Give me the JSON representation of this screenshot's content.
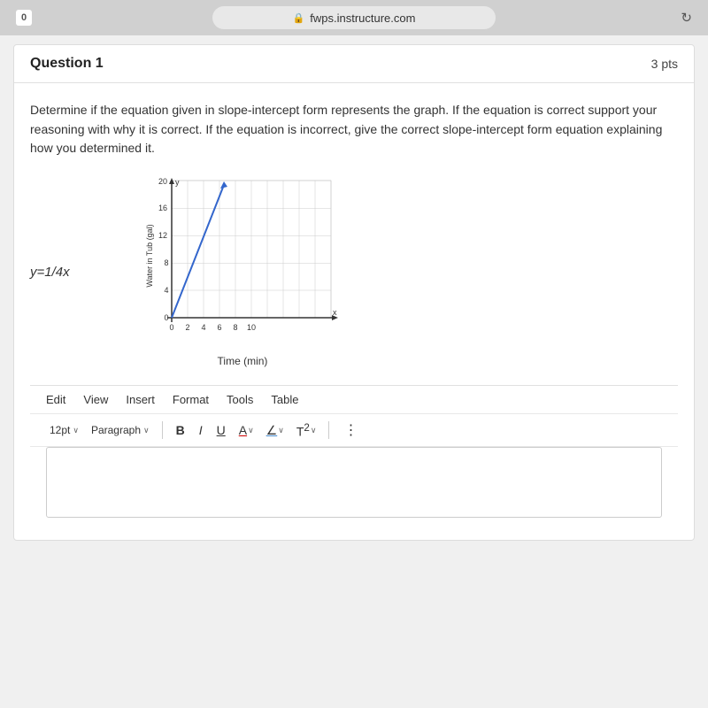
{
  "browser": {
    "tab_icon": "0",
    "url": "fwps.instructure.com",
    "lock_symbol": "🔒",
    "refresh_symbol": "↻"
  },
  "question": {
    "title": "Question 1",
    "points": "3 pts",
    "body_text": "Determine if the equation given in slope-intercept form represents the graph. If the equation is correct support your reasoning with why it is correct.  If the equation is incorrect, give the correct slope-intercept form equation explaining how you determined it.",
    "equation_label": "y=1/4x"
  },
  "graph": {
    "x_label": "Time (min)",
    "y_label": "Water in Tub (gal)",
    "x_max": 10,
    "y_max": 20,
    "x_ticks": [
      0,
      2,
      4,
      6,
      8,
      10
    ],
    "y_ticks": [
      0,
      4,
      8,
      12,
      16,
      20
    ]
  },
  "editor": {
    "menu_items": [
      "Edit",
      "View",
      "Insert",
      "Format",
      "Tools",
      "Table"
    ],
    "font_size": "12pt",
    "font_size_arrow": "∨",
    "paragraph_label": "Paragraph",
    "paragraph_arrow": "∨",
    "bold_label": "B",
    "italic_label": "I",
    "underline_label": "U",
    "color_a_label": "A",
    "color_arrow": "∨",
    "pen_label": "∠",
    "pen_arrow": "∨",
    "superscript_label": "T²",
    "superscript_arrow": "∨",
    "more_label": "⋮"
  }
}
